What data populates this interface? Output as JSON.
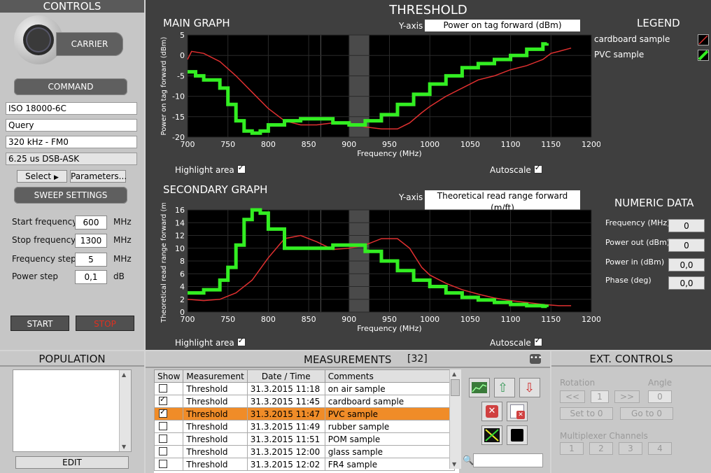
{
  "controls": {
    "title": "CONTROLS",
    "carrier_label": "CARRIER",
    "command_label": "COMMAND",
    "protocol": "ISO 18000-6C",
    "command": "Query",
    "link": "320 kHz - FM0",
    "modulation": "6.25 us DSB-ASK",
    "select_label": "Select",
    "parameters_label": "Parameters...",
    "sweep_label": "SWEEP SETTINGS",
    "start_freq_label": "Start frequency",
    "start_freq": "600",
    "start_freq_unit": "MHz",
    "stop_freq_label": "Stop frequency",
    "stop_freq": "1300",
    "stop_freq_unit": "MHz",
    "freq_step_label": "Frequency step",
    "freq_step": "5",
    "freq_step_unit": "MHz",
    "power_step_label": "Power step",
    "power_step": "0,1",
    "power_step_unit": "dB",
    "start_label": "START",
    "stop_label": "STOP",
    "stop_color": "#e03020"
  },
  "threshold": {
    "title": "THRESHOLD",
    "main_graph": "MAIN GRAPH",
    "main_yaxis_label": "Y-axis",
    "main_yaxis_value": "Power on tag forward (dBm)",
    "secondary_graph": "SECONDARY GRAPH",
    "sec_yaxis_label": "Y-axis",
    "sec_yaxis_value": "Theoretical read range forward (m/ft)",
    "highlight_label": "Highlight area",
    "autoscale_label": "Autoscale",
    "legend_title": "LEGEND",
    "numeric_title": "NUMERIC DATA",
    "numeric": [
      {
        "label": "Frequency (MHz)",
        "value": "0"
      },
      {
        "label": "Power out (dBm)",
        "value": "0"
      },
      {
        "label": "Power in (dBm)",
        "value": "0,0"
      },
      {
        "label": "Phase (deg)",
        "value": "0,0"
      }
    ]
  },
  "chart_data": [
    {
      "type": "line",
      "xlabel": "Frequency (MHz)",
      "ylabel": "Power on tag forward (dBm)",
      "xlim": [
        700,
        1200
      ],
      "ylim": [
        -20,
        5
      ],
      "xticks": [
        700,
        750,
        800,
        850,
        900,
        950,
        1000,
        1050,
        1100,
        1150,
        1200
      ],
      "yticks": [
        5,
        0,
        -5,
        -10,
        -15,
        -20
      ],
      "highlight": [
        900,
        925
      ],
      "series": [
        {
          "name": "cardboard sample",
          "color": "#e03030",
          "x": [
            700,
            705,
            720,
            740,
            760,
            780,
            800,
            820,
            840,
            860,
            880,
            900,
            920,
            940,
            960,
            975,
            990,
            1000,
            1020,
            1040,
            1060,
            1080,
            1100,
            1120,
            1140,
            1150,
            1160,
            1175
          ],
          "y": [
            -1,
            1,
            0.5,
            -1.5,
            -5,
            -9,
            -13,
            -16,
            -17,
            -17,
            -16.5,
            -16.5,
            -17.5,
            -18,
            -18,
            -16.5,
            -14,
            -12.5,
            -10,
            -8,
            -6,
            -5,
            -3.5,
            -2.5,
            -1,
            0.5,
            1,
            1.8
          ]
        },
        {
          "name": "PVC sample",
          "color": "#33ee22",
          "x": [
            700,
            710,
            720,
            740,
            750,
            760,
            770,
            780,
            790,
            800,
            820,
            840,
            860,
            880,
            900,
            920,
            940,
            960,
            980,
            1000,
            1020,
            1040,
            1060,
            1080,
            1100,
            1120,
            1140,
            1145
          ],
          "y": [
            -4,
            -5,
            -6,
            -8,
            -12,
            -16,
            -18.5,
            -19,
            -18.5,
            -17,
            -16,
            -15.5,
            -15.5,
            -16.5,
            -17,
            -16,
            -14.5,
            -12,
            -9.5,
            -7,
            -5,
            -3,
            -2,
            -1,
            0,
            1.5,
            2.8,
            3
          ]
        }
      ]
    },
    {
      "type": "line",
      "xlabel": "Frequency (MHz)",
      "ylabel": "Theoretical read range forward (m)",
      "xlim": [
        700,
        1200
      ],
      "ylim": [
        0,
        16
      ],
      "xticks": [
        700,
        750,
        800,
        850,
        900,
        950,
        1000,
        1050,
        1100,
        1150,
        1200
      ],
      "yticks": [
        16,
        14,
        12,
        10,
        8,
        6,
        4,
        2,
        0
      ],
      "highlight": [
        900,
        925
      ],
      "series": [
        {
          "name": "cardboard sample",
          "color": "#e03030",
          "x": [
            700,
            720,
            740,
            760,
            780,
            800,
            820,
            840,
            860,
            880,
            900,
            920,
            940,
            960,
            975,
            990,
            1000,
            1020,
            1040,
            1060,
            1080,
            1100,
            1120,
            1140,
            1160,
            1175
          ],
          "y": [
            2,
            1.8,
            2,
            3,
            5,
            8.5,
            11.5,
            12,
            11,
            9.8,
            10,
            10.5,
            11.5,
            11.5,
            10,
            7,
            5.8,
            4.5,
            3.5,
            2.8,
            2.2,
            1.8,
            1.5,
            1.2,
            1,
            1
          ]
        },
        {
          "name": "PVC sample",
          "color": "#33ee22",
          "x": [
            700,
            720,
            740,
            750,
            760,
            770,
            780,
            790,
            800,
            820,
            840,
            860,
            880,
            900,
            920,
            940,
            960,
            980,
            1000,
            1020,
            1040,
            1060,
            1080,
            1100,
            1120,
            1140,
            1145
          ],
          "y": [
            3,
            3.5,
            5,
            7,
            10.5,
            14.5,
            16,
            15.5,
            13,
            10,
            10,
            10,
            10.5,
            10.5,
            9.5,
            8,
            6.5,
            5,
            4,
            3,
            2.3,
            1.9,
            1.5,
            1.2,
            1,
            0.9,
            0.8
          ]
        }
      ]
    }
  ],
  "population": {
    "title": "POPULATION",
    "edit_label": "EDIT"
  },
  "measurements": {
    "title": "MEASUREMENTS",
    "count": "[32]",
    "headers": [
      "Show",
      "Measurement",
      "Date / Time",
      "Comments"
    ],
    "rows": [
      {
        "show": false,
        "measurement": "Threshold",
        "datetime": "31.3.2015 11:18",
        "comment": "on air sample",
        "selected": false
      },
      {
        "show": true,
        "measurement": "Threshold",
        "datetime": "31.3.2015 11:45",
        "comment": "cardboard sample",
        "selected": false
      },
      {
        "show": true,
        "measurement": "Threshold",
        "datetime": "31.3.2015 11:47",
        "comment": "PVC sample",
        "selected": true
      },
      {
        "show": false,
        "measurement": "Threshold",
        "datetime": "31.3.2015 11:49",
        "comment": "rubber sample",
        "selected": false
      },
      {
        "show": false,
        "measurement": "Threshold",
        "datetime": "31.3.2015 11:51",
        "comment": "POM sample",
        "selected": false
      },
      {
        "show": false,
        "measurement": "Threshold",
        "datetime": "31.3.2015 12:00",
        "comment": "glass sample",
        "selected": false
      },
      {
        "show": false,
        "measurement": "Threshold",
        "datetime": "31.3.2015 12:02",
        "comment": "FR4 sample",
        "selected": false
      }
    ]
  },
  "ext": {
    "title": "EXT. CONTROLS",
    "rotation_label": "Rotation",
    "angle_label": "Angle",
    "rot_left": "<<",
    "rot_value": "1",
    "rot_right": ">>",
    "angle_value": "0",
    "set_to_0": "Set to 0",
    "go_to_0": "Go to 0",
    "mux_label": "Multiplexer Channels",
    "channels": [
      "1",
      "2",
      "3",
      "4"
    ]
  }
}
